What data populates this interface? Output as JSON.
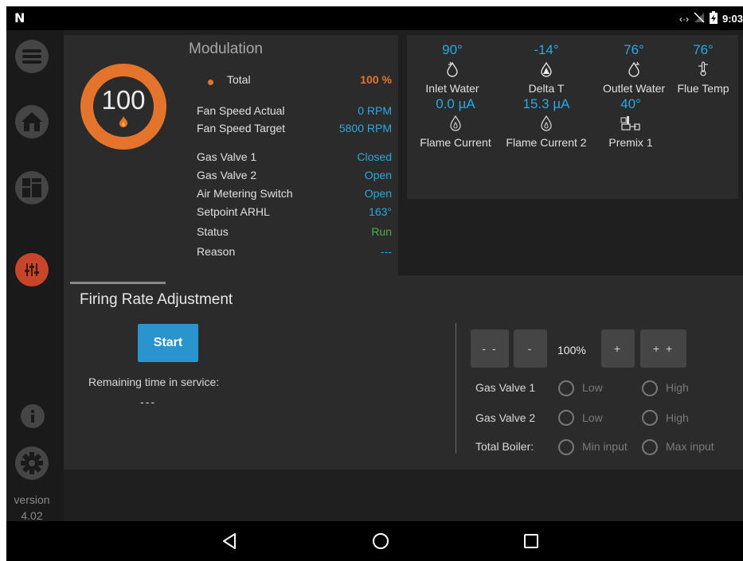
{
  "status_bar": {
    "time": "9:03",
    "logo": "N",
    "icons": [
      "data-arrows-icon",
      "no-signal-icon",
      "battery-charging-icon"
    ]
  },
  "sidebar": {
    "items": [
      {
        "name": "menu",
        "icon": "hamburger-icon"
      },
      {
        "name": "home",
        "icon": "home-icon"
      },
      {
        "name": "dashboard",
        "icon": "dashboard-icon"
      },
      {
        "name": "adjust",
        "icon": "sliders-icon"
      },
      {
        "name": "info",
        "icon": "info-icon"
      },
      {
        "name": "settings",
        "icon": "gear-icon"
      }
    ],
    "version_label": "version",
    "version_number": "4.02"
  },
  "modulation": {
    "title": "Modulation",
    "ring_value": "100",
    "ring_percent": 100,
    "total_label": "Total",
    "total_value": "100 %",
    "rows": [
      {
        "label": "Fan Speed Actual",
        "value": "0 RPM"
      },
      {
        "label": "Fan Speed Target",
        "value": "5800 RPM"
      },
      {
        "label": "Gas Valve 1",
        "value": "Closed"
      },
      {
        "label": "Gas Valve 2",
        "value": "Open"
      },
      {
        "label": "Air Metering Switch",
        "value": "Open"
      },
      {
        "label": "Setpoint ARHL",
        "value": "163°"
      },
      {
        "label": "Status",
        "value": "Run"
      },
      {
        "label": "Reason",
        "value": "---"
      }
    ]
  },
  "sensors": [
    {
      "value": "90°",
      "label": "Inlet Water",
      "icon": "inlet-water-icon"
    },
    {
      "value": "-14°",
      "label": "Delta T",
      "icon": "delta-t-icon"
    },
    {
      "value": "76°",
      "label": "Outlet Water",
      "icon": "outlet-water-icon"
    },
    {
      "value": "76°",
      "label": "Flue Temp",
      "icon": "flue-temp-icon"
    },
    {
      "value": "0.0 µA",
      "label": "Flame Current",
      "icon": "flame-current-icon"
    },
    {
      "value": "15.3 µA",
      "label": "Flame Current 2",
      "icon": "flame-current-icon"
    },
    {
      "value": "40°",
      "label": "Premix 1",
      "icon": "premix-icon"
    }
  ],
  "firing": {
    "title": "Firing Rate Adjustment",
    "start_label": "Start",
    "remaining_label": "Remaining time in service:",
    "remaining_value": "---",
    "btn_dec_big": "- -",
    "btn_dec": "-",
    "rate_value": "100%",
    "btn_inc": "+",
    "btn_inc_big": "+ +",
    "gas_valve_1_label": "Gas Valve 1",
    "gas_valve_2_label": "Gas Valve 2",
    "total_boiler_label": "Total Boiler:",
    "low_label": "Low",
    "high_label": "High",
    "min_input_label": "Min input",
    "max_input_label": "Max input"
  },
  "colors": {
    "accent_orange": "#e4742b",
    "value_blue": "#29a9e1",
    "status_green": "#4caf50",
    "start_blue": "#2a94cf"
  }
}
